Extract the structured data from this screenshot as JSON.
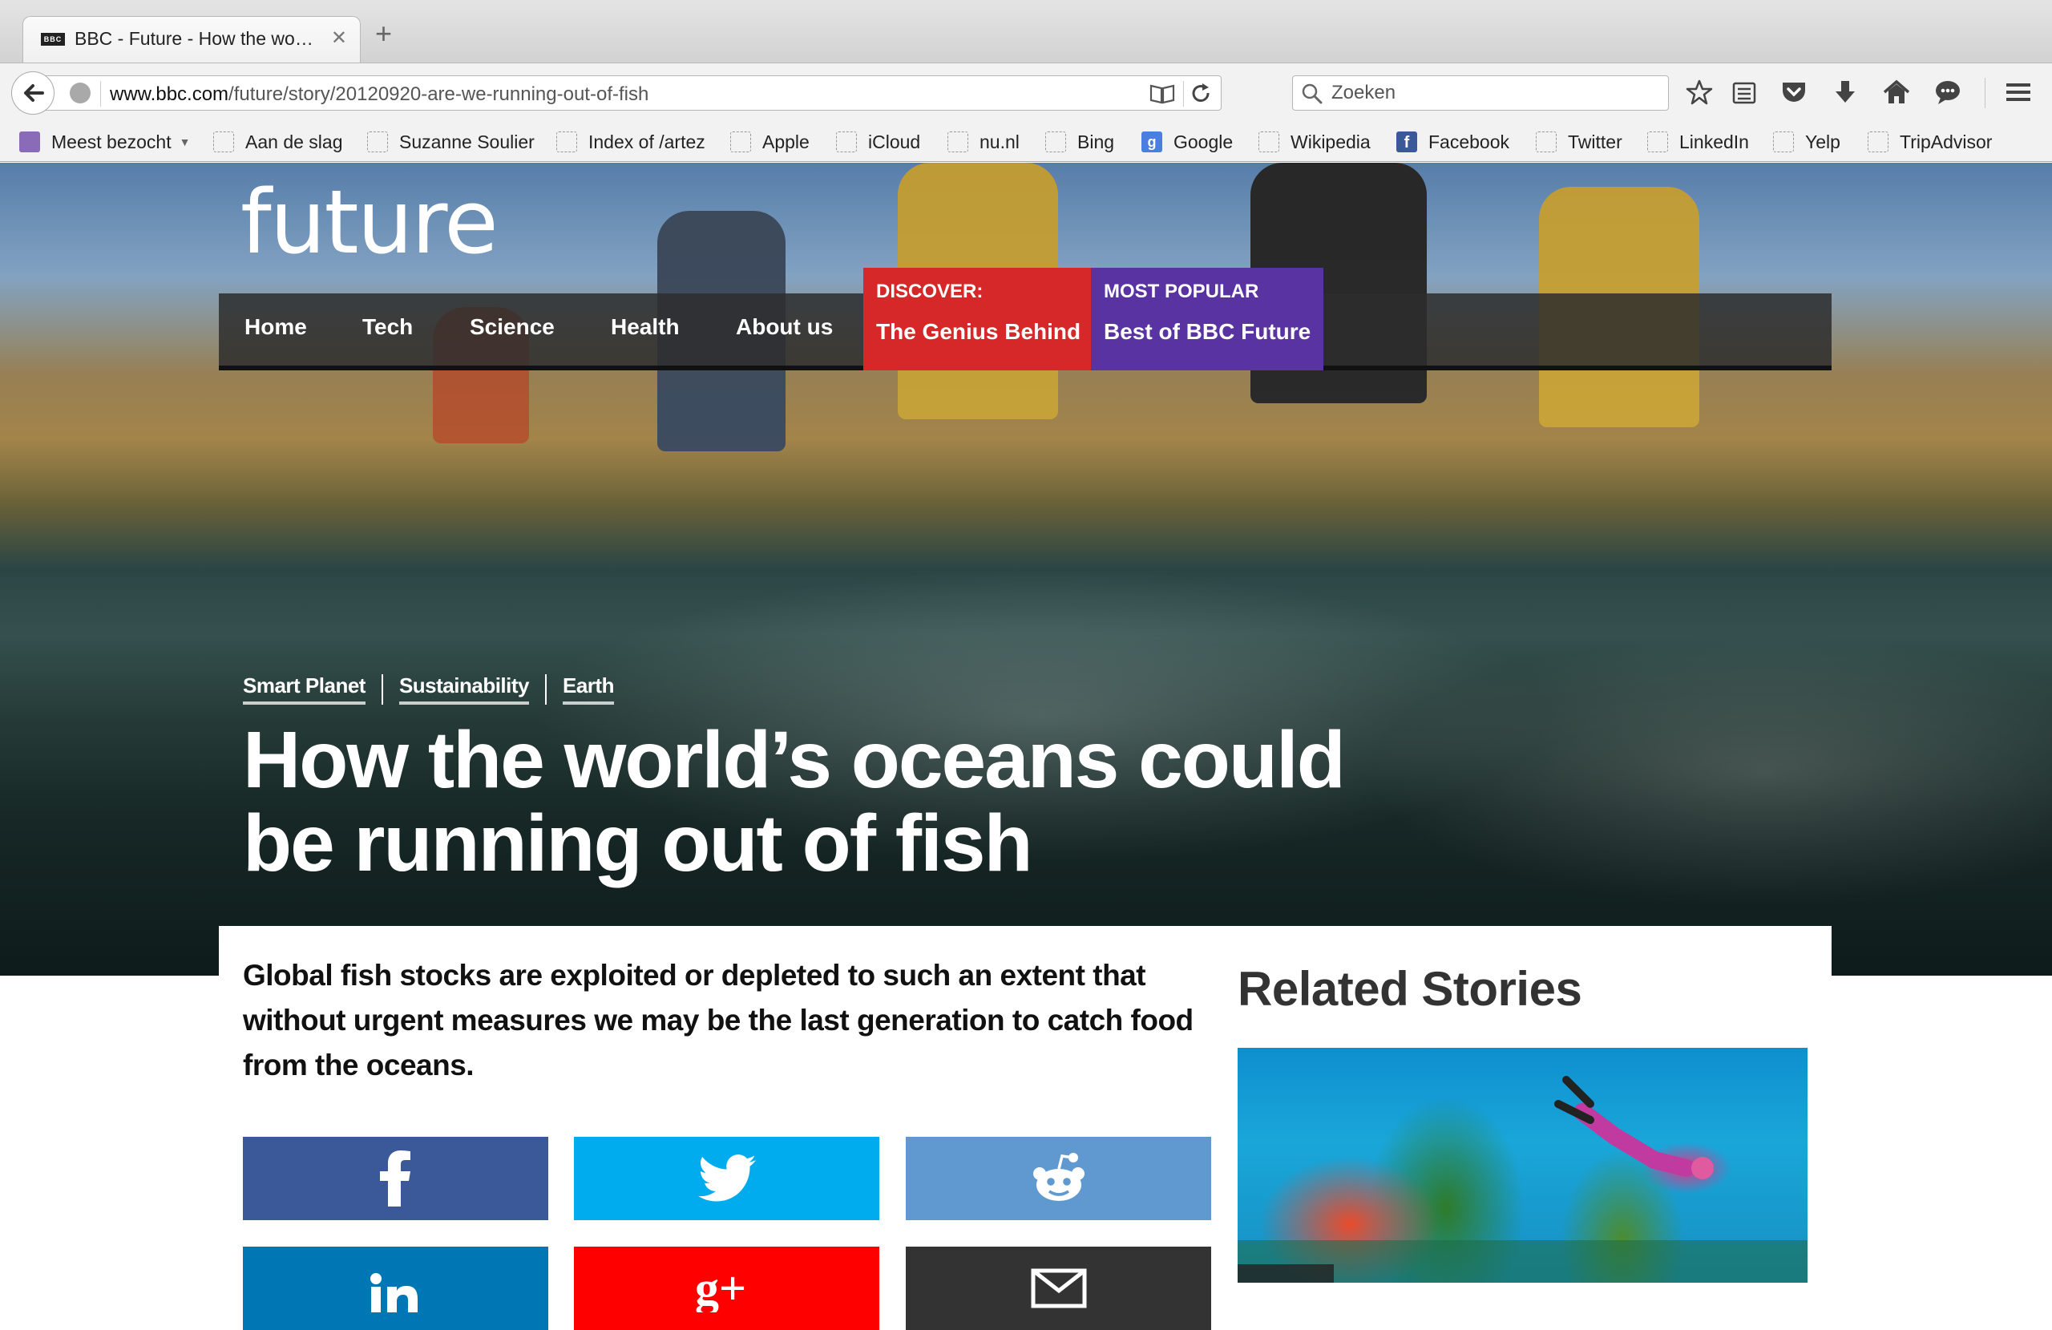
{
  "browser": {
    "tab_title": "BBC - Future - How the world's oceans could be running out of fish",
    "tab_favicon": "BBC",
    "url_domain": "www.bbc.com",
    "url_path": "/future/story/20120920-are-we-running-out-of-fish",
    "search_placeholder": "Zoeken",
    "bookmarks": [
      {
        "label": "Meest bezocht",
        "icon": "most-visited-icon"
      },
      {
        "label": "Aan de slag",
        "icon": "bookmark-icon"
      },
      {
        "label": "Suzanne Soulier",
        "icon": "bookmark-icon"
      },
      {
        "label": "Index of /artez",
        "icon": "bookmark-icon"
      },
      {
        "label": "Apple",
        "icon": "bookmark-icon"
      },
      {
        "label": "iCloud",
        "icon": "bookmark-icon"
      },
      {
        "label": "nu.nl",
        "icon": "bookmark-icon"
      },
      {
        "label": "Bing",
        "icon": "bookmark-icon"
      },
      {
        "label": "Google",
        "icon": "google-icon"
      },
      {
        "label": "Wikipedia",
        "icon": "bookmark-icon"
      },
      {
        "label": "Facebook",
        "icon": "facebook-icon"
      },
      {
        "label": "Twitter",
        "icon": "bookmark-icon"
      },
      {
        "label": "LinkedIn",
        "icon": "bookmark-icon"
      },
      {
        "label": "Yelp",
        "icon": "bookmark-icon"
      },
      {
        "label": "TripAdvisor",
        "icon": "bookmark-icon"
      }
    ],
    "toolbar_icons": [
      "star-icon",
      "reading-list-icon",
      "pocket-icon",
      "download-icon",
      "home-icon",
      "chat-icon",
      "menu-icon"
    ]
  },
  "site": {
    "logo": "future",
    "nav": [
      "Home",
      "Tech",
      "Science",
      "Health",
      "About us"
    ],
    "discover": {
      "kicker": "DISCOVER:",
      "title": "The Genius Behind",
      "color": "#d62828"
    },
    "popular": {
      "kicker": "MOST POPULAR",
      "title": "Best of BBC Future",
      "color": "#5a33a2"
    }
  },
  "article": {
    "tags": [
      "Smart Planet",
      "Sustainability",
      "Earth"
    ],
    "headline": "How the world’s oceans could be running out of fish",
    "summary": "Global fish stocks are exploited or depleted to such an extent that without urgent measures we may be the last generation to catch food from the oceans.",
    "share": [
      {
        "name": "facebook",
        "icon": "facebook-icon",
        "color": "#3b5998"
      },
      {
        "name": "twitter",
        "icon": "twitter-icon",
        "color": "#00aced"
      },
      {
        "name": "reddit",
        "icon": "reddit-icon",
        "color": "#5f99cf"
      },
      {
        "name": "linkedin",
        "icon": "linkedin-icon",
        "color": "#0077b5"
      },
      {
        "name": "googleplus",
        "icon": "google-plus-icon",
        "color": "#ff0000"
      },
      {
        "name": "email",
        "icon": "email-icon",
        "color": "#333333"
      }
    ]
  },
  "related": {
    "title": "Related Stories"
  }
}
